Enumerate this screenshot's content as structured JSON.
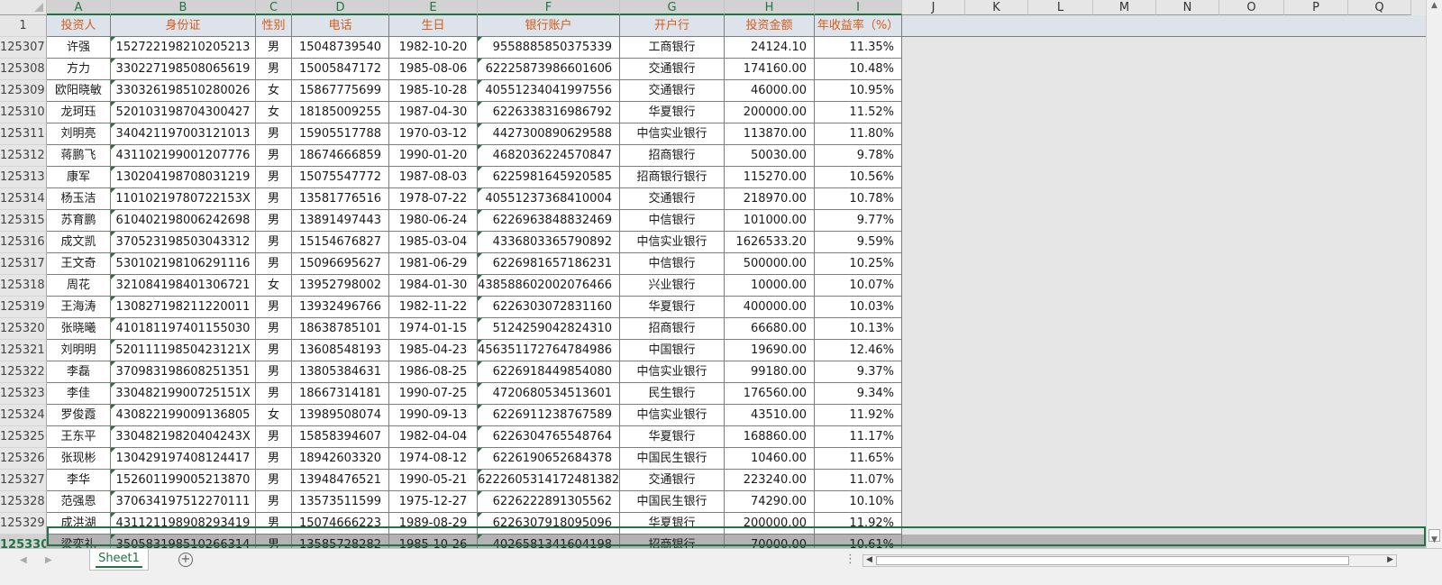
{
  "columns": [
    "A",
    "B",
    "C",
    "D",
    "E",
    "F",
    "G",
    "H",
    "I",
    "J",
    "K",
    "L",
    "M",
    "N",
    "O",
    "P",
    "Q"
  ],
  "header_row": {
    "row_number": "1",
    "labels": [
      "投资人",
      "身份证",
      "性别",
      "电话",
      "生日",
      "银行账户",
      "开户行",
      "投资金额",
      "年收益率（%）"
    ]
  },
  "rows": [
    {
      "num": "125307",
      "cells": [
        "许强",
        "152722198210205213",
        "男",
        "15048739540",
        "1982-10-20",
        "9558885850375339",
        "工商银行",
        "24124.10",
        "11.35%"
      ]
    },
    {
      "num": "125308",
      "cells": [
        "方力",
        "330227198508065619",
        "男",
        "15005847172",
        "1985-08-06",
        "6222587398660160б",
        "交通银行",
        "174160.00",
        "10.48%"
      ]
    },
    {
      "num": "125309",
      "cells": [
        "欧阳晓敏",
        "330326198510280026",
        "女",
        "15867775699",
        "1985-10-28",
        "40551234041997556",
        "交通银行",
        "46000.00",
        "10.95%"
      ]
    },
    {
      "num": "125310",
      "cells": [
        "龙珂珏",
        "520103198704300427",
        "女",
        "18185009255",
        "1987-04-30",
        "6226338316986792",
        "华夏银行",
        "200000.00",
        "11.52%"
      ]
    },
    {
      "num": "125311",
      "cells": [
        "刘明亮",
        "340421197003121013",
        "男",
        "15905517788",
        "1970-03-12",
        "4427300890629588",
        "中信实业银行",
        "113870.00",
        "11.80%"
      ]
    },
    {
      "num": "125312",
      "cells": [
        "蒋鹏飞",
        "431102199001207776",
        "男",
        "18674666859",
        "1990-01-20",
        "4682036224570847",
        "招商银行",
        "50030.00",
        "9.78%"
      ]
    },
    {
      "num": "125313",
      "cells": [
        "康军",
        "130204198708031219",
        "男",
        "15075547772",
        "1987-08-03",
        "6225981645920585",
        "招商银行银行",
        "115270.00",
        "10.56%"
      ]
    },
    {
      "num": "125314",
      "cells": [
        "杨玉洁",
        "11010219780722153X",
        "男",
        "13581776516",
        "1978-07-22",
        "40551237368410004",
        "交通银行",
        "218970.00",
        "10.78%"
      ]
    },
    {
      "num": "125315",
      "cells": [
        "苏育鹏",
        "610402198006242698",
        "男",
        "13891497443",
        "1980-06-24",
        "6226963848832469",
        "中信银行",
        "101000.00",
        "9.77%"
      ]
    },
    {
      "num": "125316",
      "cells": [
        "成文凯",
        "370523198503043312",
        "男",
        "15154676827",
        "1985-03-04",
        "4336803365790892",
        "中信实业银行",
        "1626533.20",
        "9.59%"
      ]
    },
    {
      "num": "125317",
      "cells": [
        "王文奇",
        "530102198106291116",
        "男",
        "15096695627",
        "1981-06-29",
        "6226981657186231",
        "中信银行",
        "500000.00",
        "10.25%"
      ]
    },
    {
      "num": "125318",
      "cells": [
        "周花",
        "321084198401306721",
        "女",
        "13952798002",
        "1984-01-30",
        "438588602002076466",
        "兴业银行",
        "10000.00",
        "10.07%"
      ]
    },
    {
      "num": "125319",
      "cells": [
        "王海涛",
        "130827198211220011",
        "男",
        "13932496766",
        "1982-11-22",
        "6226303072831160",
        "华夏银行",
        "400000.00",
        "10.03%"
      ]
    },
    {
      "num": "125320",
      "cells": [
        "张晓曦",
        "410181197401155030",
        "男",
        "18638785101",
        "1974-01-15",
        "5124259042824310",
        "招商银行",
        "66680.00",
        "10.13%"
      ]
    },
    {
      "num": "125321",
      "cells": [
        "刘明明",
        "52011119850423121X",
        "男",
        "13608548193",
        "1985-04-23",
        "456351172764784986",
        "中国银行",
        "19690.00",
        "12.46%"
      ]
    },
    {
      "num": "125322",
      "cells": [
        "李磊",
        "370983198608251351",
        "男",
        "13805384631",
        "1986-08-25",
        "6226918449854080",
        "中信实业银行",
        "99180.00",
        "9.37%"
      ]
    },
    {
      "num": "125323",
      "cells": [
        "李佳",
        "33048219900725151X",
        "男",
        "18667314181",
        "1990-07-25",
        "4720680534513601",
        "民生银行",
        "176560.00",
        "9.34%"
      ]
    },
    {
      "num": "125324",
      "cells": [
        "罗俊霞",
        "430822199009136805",
        "女",
        "13989508074",
        "1990-09-13",
        "6226911238767589",
        "中信实业银行",
        "43510.00",
        "11.92%"
      ]
    },
    {
      "num": "125325",
      "cells": [
        "王东平",
        "33048219820404243X",
        "男",
        "15858394607",
        "1982-04-04",
        "6226304765548764",
        "华夏银行",
        "168860.00",
        "11.17%"
      ]
    },
    {
      "num": "125326",
      "cells": [
        "张现彬",
        "130429197408124417",
        "男",
        "18942603320",
        "1974-08-12",
        "6226190652684378",
        "中国民生银行",
        "10460.00",
        "11.65%"
      ]
    },
    {
      "num": "125327",
      "cells": [
        "李华",
        "152601199005213870",
        "男",
        "13948476521",
        "1990-05-21",
        "6222605314172481382",
        "交通银行",
        "223240.00",
        "11.07%"
      ]
    },
    {
      "num": "125328",
      "cells": [
        "范强恩",
        "370634197512270111",
        "男",
        "13573511599",
        "1975-12-27",
        "6226222891305562",
        "中国民生银行",
        "74290.00",
        "10.10%"
      ]
    },
    {
      "num": "125329",
      "cells": [
        "成洪湖",
        "431121198908293419",
        "男",
        "15074666223",
        "1989-08-29",
        "6226307918095096",
        "华夏银行",
        "200000.00",
        "11.92%"
      ]
    },
    {
      "num": "125330",
      "cells": [
        "梁奕礼",
        "350583198510266314",
        "男",
        "13585728282",
        "1985-10-26",
        "4026581341604198",
        "招商银行",
        "70000.00",
        "10.61%"
      ],
      "selected": true
    }
  ],
  "sheet_tab": "Sheet1",
  "add_sheet": "+",
  "more_dots": "⋮",
  "colors": {
    "accent": "#217346",
    "header_text": "#d55b1a",
    "header_fill": "#dde3ea",
    "selected_fill": "#b3b3b3"
  }
}
